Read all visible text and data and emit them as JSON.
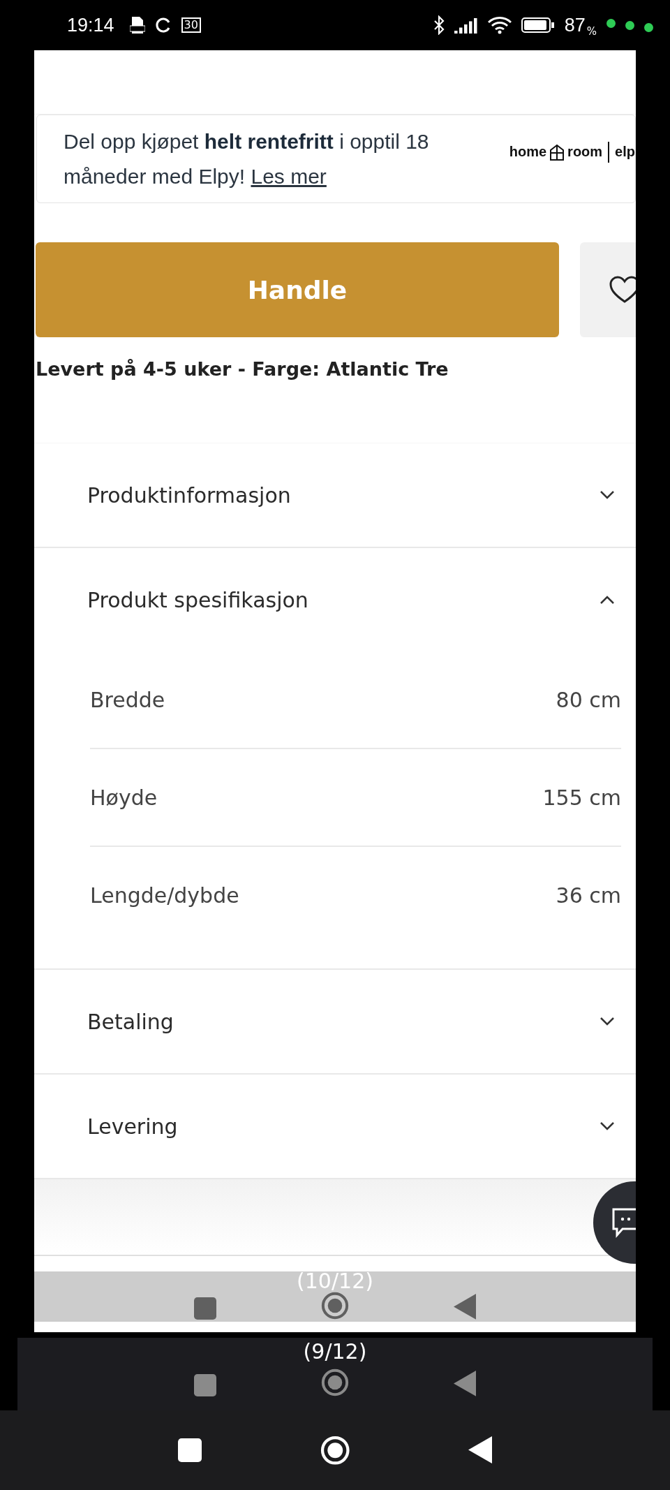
{
  "status_bar": {
    "time": "19:14",
    "calendar_day": "30",
    "battery": "87",
    "battery_unit": "%"
  },
  "banner": {
    "text": "Del opp kjøpet **helt rentefritt** i opptil 18 måneder med Elpy!",
    "link": "Les mer",
    "logo": [
      "home",
      "room",
      "elp"
    ]
  },
  "buy_button": {
    "label": "Handle"
  },
  "delivery_note": "Levert på 4-5 uker - Farge: Atlantic Tre",
  "sections": [
    {
      "title": "Produktinformasjon",
      "expanded": false
    },
    {
      "title": "Produkt spesifikasjon",
      "expanded": true,
      "specs": [
        {
          "label": "Bredde",
          "value": "80 cm"
        },
        {
          "label": "Høyde",
          "value": "155 cm"
        },
        {
          "label": "Lengde/dybde",
          "value": "36 cm"
        }
      ]
    },
    {
      "title": "Betaling",
      "expanded": false
    },
    {
      "title": "Levering",
      "expanded": false
    }
  ],
  "overlays": [
    {
      "kind": "light",
      "caption": "(10/12)"
    },
    {
      "kind": "dark",
      "caption": "(9/12)"
    }
  ]
}
